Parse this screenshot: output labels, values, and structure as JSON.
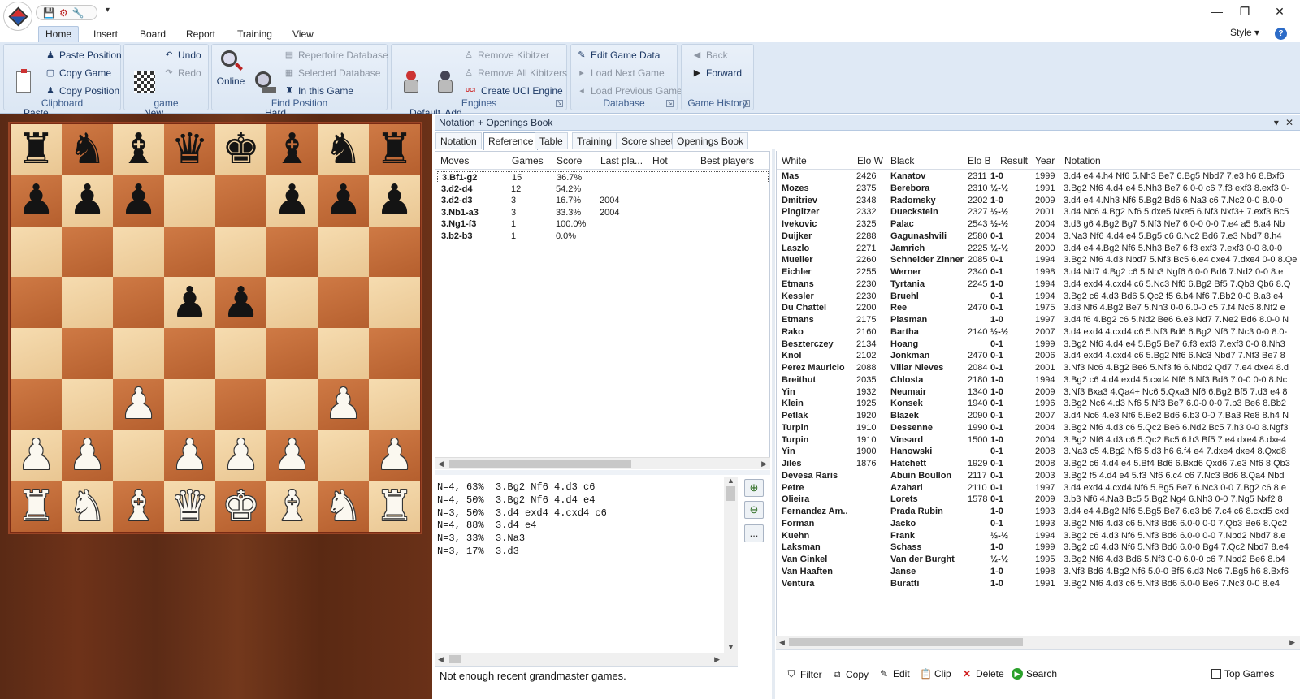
{
  "titlebar": {
    "quick_access": [
      "save-icon",
      "database-icon",
      "tools-icon"
    ],
    "more": "▾",
    "minimize": "—",
    "maximize": "❐",
    "close": "✕"
  },
  "ribbon": {
    "tabs": [
      "Home",
      "Insert",
      "Board",
      "Report",
      "Training",
      "View"
    ],
    "active_tab": "Home",
    "style_label": "Style",
    "groups": {
      "clipboard": {
        "label": "Clipboard",
        "paste_game": "Paste\nGame",
        "paste_position": "Paste Position",
        "copy_game": "Copy Game",
        "copy_position": "Copy Position"
      },
      "game": {
        "label": "game",
        "new_game": "New\nGame",
        "undo": "Undo",
        "redo": "Redo"
      },
      "find_position": {
        "label": "Find Position",
        "online": "Online",
        "hard_disk": "Hard\nDisk",
        "repertoire_database": "Repertoire Database",
        "selected_database": "Selected Database",
        "in_this_game": "In this Game"
      },
      "engines": {
        "label": "Engines",
        "default_kibitzer": "Default\nKibitzer",
        "add_kibitzer": "Add\nKibitzer",
        "remove_kibitzer": "Remove Kibitzer",
        "remove_all_kibitzers": "Remove All Kibitzers",
        "create_uci_engine": "Create UCI Engine",
        "uci_badge": "UCI"
      },
      "database": {
        "label": "Database",
        "edit_game_data": "Edit Game Data",
        "load_next_game": "Load Next Game",
        "load_previous_game": "Load Previous Game"
      },
      "game_history": {
        "label": "Game History",
        "back": "Back",
        "forward": "Forward"
      }
    }
  },
  "board": {
    "ranks": [
      [
        "br",
        "bn",
        "bb",
        "bq",
        "bk",
        "bb",
        "bn",
        "br"
      ],
      [
        "bp",
        "bp",
        "bp",
        "",
        "",
        "bp",
        "bp",
        "bp"
      ],
      [
        "",
        "",
        "",
        "",
        "",
        "",
        "",
        ""
      ],
      [
        "",
        "",
        "",
        "bp",
        "bp",
        "",
        "",
        ""
      ],
      [
        "",
        "",
        "",
        "",
        "",
        "",
        "",
        ""
      ],
      [
        "",
        "",
        "wp",
        "",
        "",
        "",
        "wp",
        ""
      ],
      [
        "wp",
        "wp",
        "",
        "wp",
        "wp",
        "wp",
        "",
        "wp"
      ],
      [
        "wr",
        "wn",
        "wb",
        "wq",
        "wk",
        "wb",
        "wn",
        "wr"
      ]
    ]
  },
  "panel": {
    "title": "Notation + Openings Book",
    "pin": "▾",
    "close": "✕",
    "tabs": [
      "Notation",
      "Reference",
      "Table",
      "Training",
      "Score sheet",
      "Openings Book"
    ],
    "active_tab": "Reference"
  },
  "moves": {
    "headers": [
      "Moves",
      "Games",
      "Score",
      "Last pla...",
      "Hot",
      "Best players"
    ],
    "rows": [
      {
        "move": "3.Bf1-g2",
        "games": "15",
        "score": "36.7%",
        "last": "",
        "hot": "",
        "best": ""
      },
      {
        "move": "3.d2-d4",
        "games": "12",
        "score": "54.2%",
        "last": "",
        "hot": "",
        "best": ""
      },
      {
        "move": "3.d2-d3",
        "games": "3",
        "score": "16.7%",
        "last": "2004",
        "hot": "",
        "best": ""
      },
      {
        "move": "3.Nb1-a3",
        "games": "3",
        "score": "33.3%",
        "last": "2004",
        "hot": "",
        "best": ""
      },
      {
        "move": "3.Ng1-f3",
        "games": "1",
        "score": "100.0%",
        "last": "",
        "hot": "",
        "best": ""
      },
      {
        "move": "3.b2-b3",
        "games": "1",
        "score": "0.0%",
        "last": "",
        "hot": "",
        "best": ""
      }
    ]
  },
  "stats_lines": [
    "N=4, 63%  3.Bg2 Nf6 4.d3 c6",
    "N=4, 50%  3.Bg2 Nf6 4.d4 e4",
    "N=3, 50%  3.d4 exd4 4.cxd4 c6",
    "N=4, 88%  3.d4 e4",
    "N=3, 33%  3.Na3",
    "N=3, 17%  3.d3"
  ],
  "zoom": {
    "zoom_in": "⊕",
    "zoom_out": "⊖",
    "more": "..."
  },
  "status_message": "Not enough recent grandmaster games.",
  "games": {
    "headers": [
      "White",
      "Elo W",
      "Black",
      "Elo B",
      "Result",
      "Year",
      "Notation"
    ],
    "rows": [
      {
        "white": "Mas",
        "elow": "2426",
        "black": "Kanatov",
        "elob": "2311",
        "result": "1-0",
        "year": "1999",
        "notation": "3.d4 e4 4.h4 Nf6 5.Nh3 Be7 6.Bg5 Nbd7 7.e3 h6 8.Bxf6"
      },
      {
        "white": "Mozes",
        "elow": "2375",
        "black": "Berebora",
        "elob": "2310",
        "result": "½-½",
        "year": "1991",
        "notation": "3.Bg2 Nf6 4.d4 e4 5.Nh3 Be7 6.0-0 c6 7.f3 exf3 8.exf3 0-"
      },
      {
        "white": "Dmitriev",
        "elow": "2348",
        "black": "Radomsky",
        "elob": "2202",
        "result": "1-0",
        "year": "2009",
        "notation": "3.d4 e4 4.Nh3 Nf6 5.Bg2 Bd6 6.Na3 c6 7.Nc2 0-0 8.0-0"
      },
      {
        "white": "Pingitzer",
        "elow": "2332",
        "black": "Dueckstein",
        "elob": "2327",
        "result": "½-½",
        "year": "2001",
        "notation": "3.d4 Nc6 4.Bg2 Nf6 5.dxe5 Nxe5 6.Nf3 Nxf3+ 7.exf3 Bc5"
      },
      {
        "white": "Ivekovic",
        "elow": "2325",
        "black": "Palac",
        "elob": "2543",
        "result": "½-½",
        "year": "2004",
        "notation": "3.d3 g6 4.Bg2 Bg7 5.Nf3 Ne7 6.0-0 0-0 7.e4 a5 8.a4 Nb"
      },
      {
        "white": "Duijker",
        "elow": "2288",
        "black": "Gagunashvili",
        "elob": "2580",
        "result": "0-1",
        "year": "2004",
        "notation": "3.Na3 Nf6 4.d4 e4 5.Bg5 c6 6.Nc2 Bd6 7.e3 Nbd7 8.h4"
      },
      {
        "white": "Laszlo",
        "elow": "2271",
        "black": "Jamrich",
        "elob": "2225",
        "result": "½-½",
        "year": "2000",
        "notation": "3.d4 e4 4.Bg2 Nf6 5.Nh3 Be7 6.f3 exf3 7.exf3 0-0 8.0-0"
      },
      {
        "white": "Mueller",
        "elow": "2260",
        "black": "Schneider Zinner",
        "elob": "2085",
        "result": "0-1",
        "year": "1994",
        "notation": "3.Bg2 Nf6 4.d3 Nbd7 5.Nf3 Bc5 6.e4 dxe4 7.dxe4 0-0 8.Qe"
      },
      {
        "white": "Eichler",
        "elow": "2255",
        "black": "Werner",
        "elob": "2340",
        "result": "0-1",
        "year": "1998",
        "notation": "3.d4 Nd7 4.Bg2 c6 5.Nh3 Ngf6 6.0-0 Bd6 7.Nd2 0-0 8.e"
      },
      {
        "white": "Etmans",
        "elow": "2230",
        "black": "Tyrtania",
        "elob": "2245",
        "result": "1-0",
        "year": "1994",
        "notation": "3.d4 exd4 4.cxd4 c6 5.Nc3 Nf6 6.Bg2 Bf5 7.Qb3 Qb6 8.Q"
      },
      {
        "white": "Kessler",
        "elow": "2230",
        "black": "Bruehl",
        "elob": "",
        "result": "0-1",
        "year": "1994",
        "notation": "3.Bg2 c6 4.d3 Bd6 5.Qc2 f5 6.b4 Nf6 7.Bb2 0-0 8.a3 e4"
      },
      {
        "white": "Du Chattel",
        "elow": "2200",
        "black": "Ree",
        "elob": "2470",
        "result": "0-1",
        "year": "1975",
        "notation": "3.d3 Nf6 4.Bg2 Be7 5.Nh3 0-0 6.0-0 c5 7.f4 Nc6 8.Nf2 e"
      },
      {
        "white": "Etmans",
        "elow": "2175",
        "black": "Plasman",
        "elob": "",
        "result": "1-0",
        "year": "1997",
        "notation": "3.d4 f6 4.Bg2 c6 5.Nd2 Be6 6.e3 Nd7 7.Ne2 Bd6 8.0-0 N"
      },
      {
        "white": "Rako",
        "elow": "2160",
        "black": "Bartha",
        "elob": "2140",
        "result": "½-½",
        "year": "2007",
        "notation": "3.d4 exd4 4.cxd4 c6 5.Nf3 Bd6 6.Bg2 Nf6 7.Nc3 0-0 8.0-"
      },
      {
        "white": "Beszterczey",
        "elow": "2134",
        "black": "Hoang",
        "elob": "",
        "result": "0-1",
        "year": "1999",
        "notation": "3.Bg2 Nf6 4.d4 e4 5.Bg5 Be7 6.f3 exf3 7.exf3 0-0 8.Nh3"
      },
      {
        "white": "Knol",
        "elow": "2102",
        "black": "Jonkman",
        "elob": "2470",
        "result": "0-1",
        "year": "2006",
        "notation": "3.d4 exd4 4.cxd4 c6 5.Bg2 Nf6 6.Nc3 Nbd7 7.Nf3 Be7 8"
      },
      {
        "white": "Perez Mauricio",
        "elow": "2088",
        "black": "Villar Nieves",
        "elob": "2084",
        "result": "0-1",
        "year": "2001",
        "notation": "3.Nf3 Nc6 4.Bg2 Be6 5.Nf3 f6 6.Nbd2 Qd7 7.e4 dxe4 8.d"
      },
      {
        "white": "Breithut",
        "elow": "2035",
        "black": "Chlosta",
        "elob": "2180",
        "result": "1-0",
        "year": "1994",
        "notation": "3.Bg2 c6 4.d4 exd4 5.cxd4 Nf6 6.Nf3 Bd6 7.0-0 0-0 8.Nc"
      },
      {
        "white": "Yin",
        "elow": "1932",
        "black": "Neumair",
        "elob": "1340",
        "result": "1-0",
        "year": "2009",
        "notation": "3.Nf3 Bxa3 4.Qa4+ Nc6 5.Qxa3 Nf6 6.Bg2 Bf5 7.d3 e4 8"
      },
      {
        "white": "Klein",
        "elow": "1925",
        "black": "Konsek",
        "elob": "1940",
        "result": "0-1",
        "year": "1996",
        "notation": "3.Bg2 Nc6 4.d3 Nf6 5.Nf3 Be7 6.0-0 0-0 7.b3 Be6 8.Bb2"
      },
      {
        "white": "Petlak",
        "elow": "1920",
        "black": "Blazek",
        "elob": "2090",
        "result": "0-1",
        "year": "2007",
        "notation": "3.d4 Nc6 4.e3 Nf6 5.Be2 Bd6 6.b3 0-0 7.Ba3 Re8 8.h4 N"
      },
      {
        "white": "Turpin",
        "elow": "1910",
        "black": "Dessenne",
        "elob": "1990",
        "result": "0-1",
        "year": "2004",
        "notation": "3.Bg2 Nf6 4.d3 c6 5.Qc2 Be6 6.Nd2 Bc5 7.h3 0-0 8.Ngf3"
      },
      {
        "white": "Turpin",
        "elow": "1910",
        "black": "Vinsard",
        "elob": "1500",
        "result": "1-0",
        "year": "2004",
        "notation": "3.Bg2 Nf6 4.d3 c6 5.Qc2 Bc5 6.h3 Bf5 7.e4 dxe4 8.dxe4"
      },
      {
        "white": "Yin",
        "elow": "1900",
        "black": "Hanowski",
        "elob": "",
        "result": "0-1",
        "year": "2008",
        "notation": "3.Na3 c5 4.Bg2 Nf6 5.d3 h6 6.f4 e4 7.dxe4 dxe4 8.Qxd8"
      },
      {
        "white": "Jiles",
        "elow": "1876",
        "black": "Hatchett",
        "elob": "1929",
        "result": "0-1",
        "year": "2008",
        "notation": "3.Bg2 c6 4.d4 e4 5.Bf4 Bd6 6.Bxd6 Qxd6 7.e3 Nf6 8.Qb3"
      },
      {
        "white": "Devesa Raris",
        "elow": "",
        "black": "Abuin Boullon",
        "elob": "2117",
        "result": "0-1",
        "year": "2003",
        "notation": "3.Bg2 f5 4.d4 e4 5.f3 Nf6 6.c4 c6 7.Nc3 Bd6 8.Qa4 Nbd"
      },
      {
        "white": "Petre",
        "elow": "",
        "black": "Azahari",
        "elob": "2110",
        "result": "0-1",
        "year": "1997",
        "notation": "3.d4 exd4 4.cxd4 Nf6 5.Bg5 Be7 6.Nc3 0-0 7.Bg2 c6 8.e"
      },
      {
        "white": "Olieira",
        "elow": "",
        "black": "Lorets",
        "elob": "1578",
        "result": "0-1",
        "year": "2009",
        "notation": "3.b3 Nf6 4.Na3 Bc5 5.Bg2 Ng4 6.Nh3 0-0 7.Ng5 Nxf2 8"
      },
      {
        "white": "Fernandez Am..",
        "elow": "",
        "black": "Prada Rubin",
        "elob": "",
        "result": "1-0",
        "year": "1993",
        "notation": "3.d4 e4 4.Bg2 Nf6 5.Bg5 Be7 6.e3 b6 7.c4 c6 8.cxd5 cxd"
      },
      {
        "white": "Forman",
        "elow": "",
        "black": "Jacko",
        "elob": "",
        "result": "0-1",
        "year": "1993",
        "notation": "3.Bg2 Nf6 4.d3 c6 5.Nf3 Bd6 6.0-0 0-0 7.Qb3 Be6 8.Qc2"
      },
      {
        "white": "Kuehn",
        "elow": "",
        "black": "Frank",
        "elob": "",
        "result": "½-½",
        "year": "1994",
        "notation": "3.Bg2 c6 4.d3 Nf6 5.Nf3 Bd6 6.0-0 0-0 7.Nbd2 Nbd7 8.e"
      },
      {
        "white": "Laksman",
        "elow": "",
        "black": "Schass",
        "elob": "",
        "result": "1-0",
        "year": "1999",
        "notation": "3.Bg2 c6 4.d3 Nf6 5.Nf3 Bd6 6.0-0 Bg4 7.Qc2 Nbd7 8.e4"
      },
      {
        "white": "Van Ginkel",
        "elow": "",
        "black": "Van der Burght",
        "elob": "",
        "result": "½-½",
        "year": "1995",
        "notation": "3.Bg2 Nf6 4.d3 Bd6 5.Nf3 0-0 6.0-0 c6 7.Nbd2 Be6 8.b4"
      },
      {
        "white": "Van Haaften",
        "elow": "",
        "black": "Janse",
        "elob": "",
        "result": "1-0",
        "year": "1998",
        "notation": "3.Nf3 Bd6 4.Bg2 Nf6 5.0-0 Bf5 6.d3 Nc6 7.Bg5 h6 8.Bxf6"
      },
      {
        "white": "Ventura",
        "elow": "",
        "black": "Buratti",
        "elob": "",
        "result": "1-0",
        "year": "1991",
        "notation": "3.Bg2 Nf6 4.d3 c6 5.Nf3 Bd6 6.0-0 Be6 7.Nc3 0-0 8.e4"
      }
    ]
  },
  "games_toolbar": {
    "filter": "Filter",
    "copy": "Copy",
    "edit": "Edit",
    "clip": "Clip",
    "delete": "Delete",
    "search": "Search",
    "top_games": "Top Games"
  }
}
